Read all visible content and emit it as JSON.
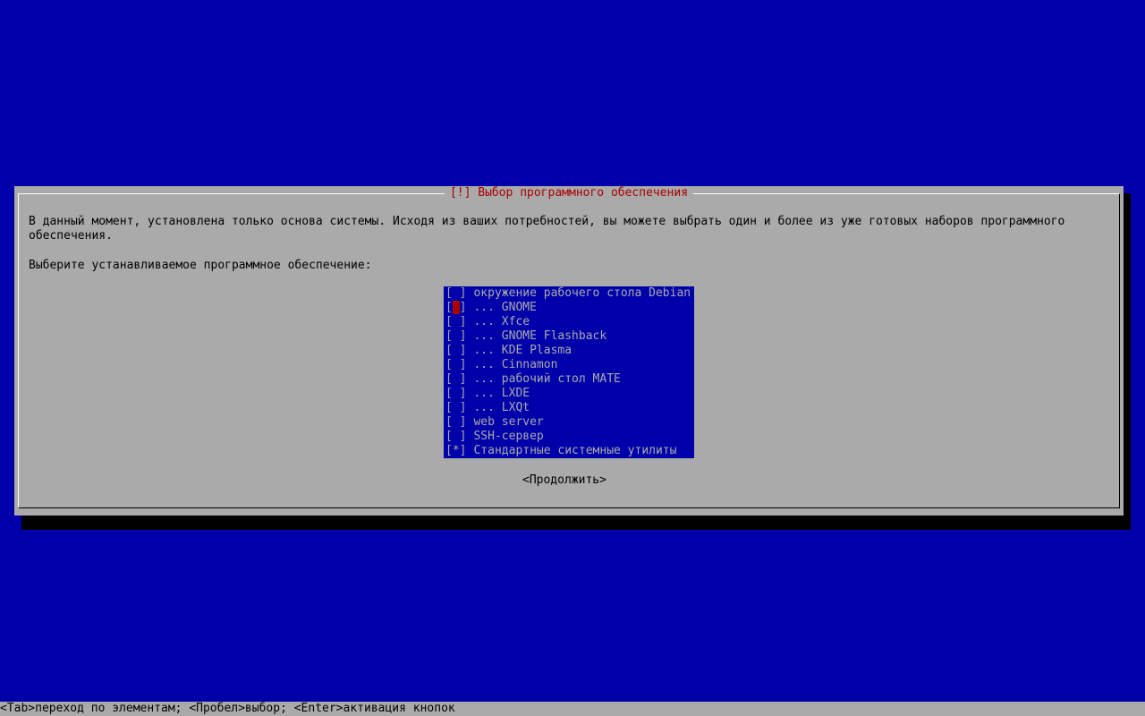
{
  "dialog": {
    "title": "[!] Выбор программного обеспечения",
    "description": "В данный момент, установлена только основа системы. Исходя из ваших потребностей, вы можете выбрать один и более из уже готовых наборов программного обеспечения.",
    "prompt": "Выберите устанавливаемое программное обеспечение:",
    "continue_label": "<Продолжить>"
  },
  "software_list": [
    {
      "checked": false,
      "label": "окружение рабочего стола Debian"
    },
    {
      "checked": false,
      "label": "... GNOME",
      "cursor": true
    },
    {
      "checked": false,
      "label": "... Xfce"
    },
    {
      "checked": false,
      "label": "... GNOME Flashback"
    },
    {
      "checked": false,
      "label": "... KDE Plasma"
    },
    {
      "checked": false,
      "label": "... Cinnamon"
    },
    {
      "checked": false,
      "label": "... рабочий стол MATE"
    },
    {
      "checked": false,
      "label": "... LXDE"
    },
    {
      "checked": false,
      "label": "... LXQt"
    },
    {
      "checked": false,
      "label": "web server"
    },
    {
      "checked": false,
      "label": "SSH-сервер"
    },
    {
      "checked": true,
      "label": "Стандартные системные утилиты"
    }
  ],
  "status_bar": {
    "text": "<Tab>переход по элементам; <Пробел>выбор; <Enter>активация кнопок"
  },
  "colors": {
    "background": "#0000aa",
    "dialog": "#aaaaaa",
    "title": "#aa0000",
    "list_bg": "#0000aa",
    "list_fg": "#aaaaaa",
    "cursor": "#aa0000"
  }
}
